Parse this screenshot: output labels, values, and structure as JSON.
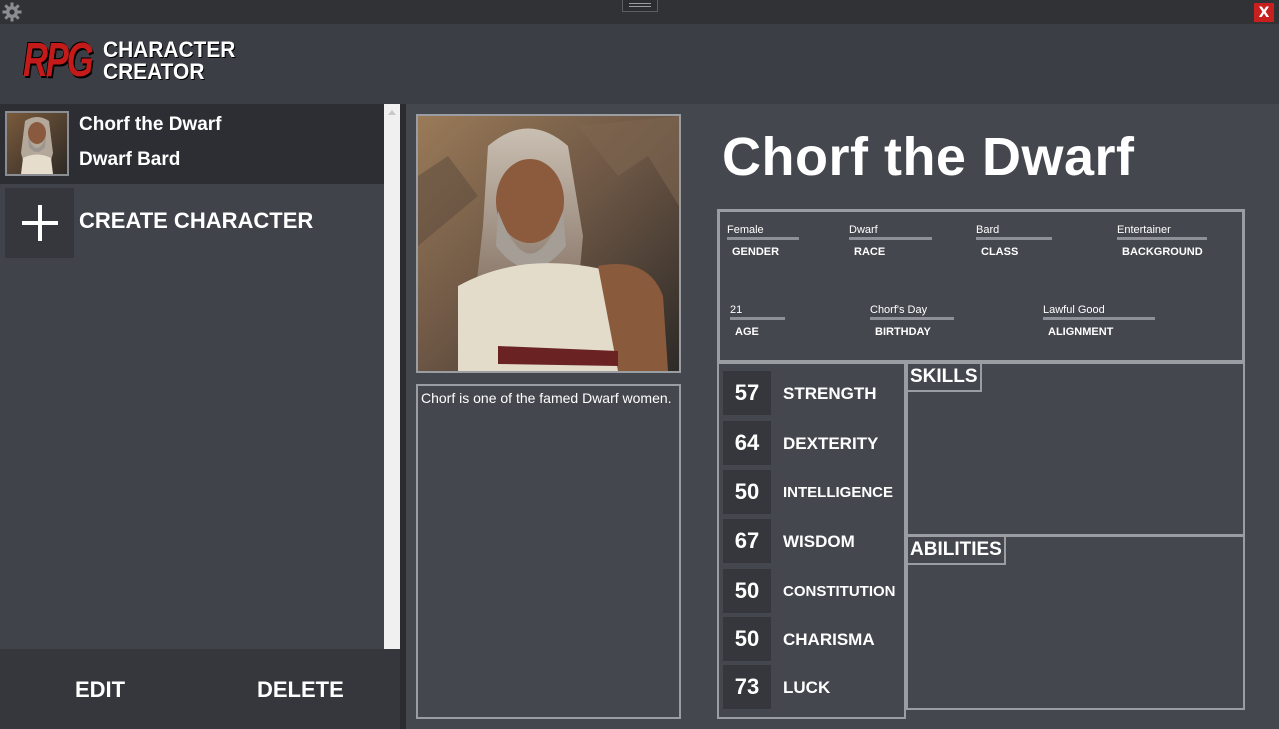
{
  "window": {
    "close_label": "X"
  },
  "logo": {
    "rpg": "RPG",
    "line1": "CHARACTER",
    "line2": "CREATOR"
  },
  "sidebar": {
    "characters": [
      {
        "name": "Chorf the Dwarf",
        "subtitle": "Dwarf Bard"
      }
    ],
    "create_label": "CREATE CHARACTER",
    "edit_label": "EDIT",
    "delete_label": "DELETE"
  },
  "character": {
    "name": "Chorf the Dwarf",
    "description": "Chorf is one of the famed Dwarf women.",
    "fields": {
      "gender": {
        "value": "Female",
        "label": "GENDER"
      },
      "race": {
        "value": "Dwarf",
        "label": "RACE"
      },
      "class": {
        "value": "Bard",
        "label": "CLASS"
      },
      "background": {
        "value": "Entertainer",
        "label": "BACKGROUND"
      },
      "age": {
        "value": "21",
        "label": "AGE"
      },
      "birthday": {
        "value": "Chorf's Day",
        "label": "BIRTHDAY"
      },
      "alignment": {
        "value": "Lawful Good",
        "label": "ALIGNMENT"
      }
    },
    "stats": [
      {
        "value": "57",
        "label": "STRENGTH"
      },
      {
        "value": "64",
        "label": "DEXTERITY"
      },
      {
        "value": "50",
        "label": "INTELLIGENCE"
      },
      {
        "value": "67",
        "label": "WISDOM"
      },
      {
        "value": "50",
        "label": "CONSTITUTION"
      },
      {
        "value": "50",
        "label": "CHARISMA"
      },
      {
        "value": "73",
        "label": "LUCK"
      }
    ],
    "skills_label": "SKILLS",
    "abilities_label": "ABILITIES"
  }
}
